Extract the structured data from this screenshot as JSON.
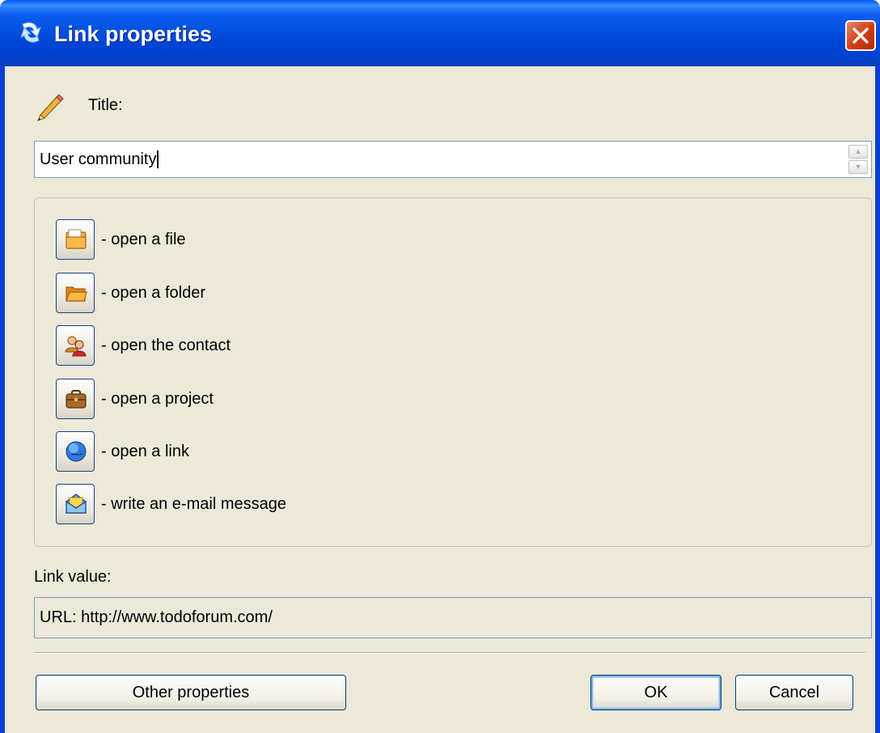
{
  "window": {
    "title": "Link properties",
    "close_label": "Close"
  },
  "title_field": {
    "label": "Title:",
    "value": "User community"
  },
  "actions": [
    {
      "icon": "file-icon",
      "label": "- open a file"
    },
    {
      "icon": "folder-icon",
      "label": "- open a folder"
    },
    {
      "icon": "contact-icon",
      "label": "- open the contact"
    },
    {
      "icon": "briefcase-icon",
      "label": "- open a project"
    },
    {
      "icon": "globe-icon",
      "label": "- open a link"
    },
    {
      "icon": "envelope-icon",
      "label": "- write an e-mail message"
    }
  ],
  "link_value": {
    "label": "Link value:",
    "value": "URL: http://www.todoforum.com/"
  },
  "buttons": {
    "other_properties": "Other properties",
    "ok": "OK",
    "cancel": "Cancel"
  },
  "colors": {
    "titlebar": "#0047d8",
    "dialog_bg": "#ece9d8",
    "close_button": "#d33a12"
  }
}
